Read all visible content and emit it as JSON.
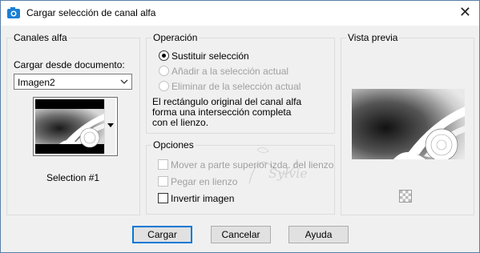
{
  "window": {
    "title": "Cargar selección de canal alfa",
    "close_glyph": "✕"
  },
  "channels": {
    "group_title": "Canales alfa",
    "load_from_label": "Cargar desde documento:",
    "document_value": "Imagen2",
    "selection_name": "Selection #1"
  },
  "operation": {
    "group_title": "Operación",
    "options": [
      {
        "label": "Sustituir selección",
        "selected": true,
        "enabled": true
      },
      {
        "label": "Añadir a la selección actual",
        "selected": false,
        "enabled": false
      },
      {
        "label": "Eliminar de la selección actual",
        "selected": false,
        "enabled": false
      }
    ],
    "description": "El rectángulo original del canal alfa forma una intersección completa con el lienzo."
  },
  "options": {
    "group_title": "Opciones",
    "items": [
      {
        "label": "Mover a parte superior izda. del lienzo",
        "checked": false,
        "enabled": false
      },
      {
        "label": "Pegar en lienzo",
        "checked": false,
        "enabled": false
      },
      {
        "label": "Invertir imagen",
        "checked": false,
        "enabled": true
      }
    ]
  },
  "preview": {
    "group_title": "Vista previa",
    "icon": "transparency-checker-icon"
  },
  "buttons": {
    "load": "Cargar",
    "cancel": "Cancelar",
    "help": "Ayuda"
  },
  "watermark": "Sylvie"
}
